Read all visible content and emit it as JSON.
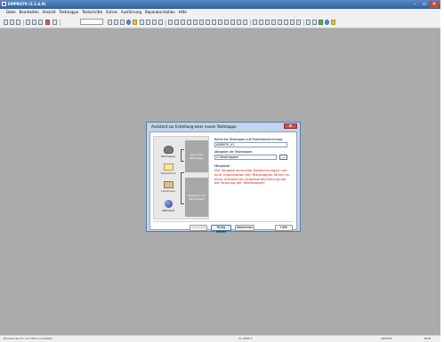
{
  "app": {
    "title": "EMPRO70 (2.1.6.0)"
  },
  "window_controls": {
    "minimize": "–",
    "maximize": "▫",
    "close": "✕"
  },
  "menu": [
    "Datei",
    "Bearbeiten",
    "Ansicht",
    "Testmappe",
    "Testschritte",
    "Extras",
    "Ausführung",
    "Reparaturstation",
    "Hilfe"
  ],
  "status": {
    "left": "Drücken Sie F1, um Hilfe zu erhalten",
    "center": "V1 0006.1",
    "right1": "ADMATE",
    "right2": "NUM"
  },
  "dialog": {
    "title": "Assistent zur Erstellung einer neuen Testmappe",
    "close": "x",
    "wizard": {
      "steps": [
        {
          "label": "Testmappe",
          "icon": "gear-icon"
        },
        {
          "label": "Verzeichnis",
          "icon": "folder-icon"
        },
        {
          "label": "Lauchvers",
          "icon": "cube-icon"
        },
        {
          "label": "Nachlauf",
          "icon": "globe-icon"
        }
      ],
      "groups": [
        {
          "label": "Name der Testmappe"
        },
        {
          "label": "Ablageort der Testmappen"
        }
      ]
    },
    "form": {
      "name_label": "Name der Testmappe (z.B.Produktbezeichnung):",
      "name_value": "ADM070_V1",
      "path_label": "Ablageort der Testmappen:",
      "path_value": "C:\\Testmappen",
      "browse": "...",
      "hint_title": "Hinweis!",
      "hint_text": "Die Vergabe sinnvoller Bezeichnungen und eine Organisation der Testmappen führen zu einer erheblichen Arbeitserleichterung bei der Nutzung der Testmappen!"
    },
    "buttons": {
      "back": "< Zurück",
      "finish": "Fertig stellen",
      "cancel": "Abbrechen",
      "help": "Hilfe"
    }
  },
  "colors": {
    "workspace": "#ababab",
    "titlebar": "#2f5f9e",
    "hint": "#d02020",
    "hint_title": "#2a5db0"
  }
}
